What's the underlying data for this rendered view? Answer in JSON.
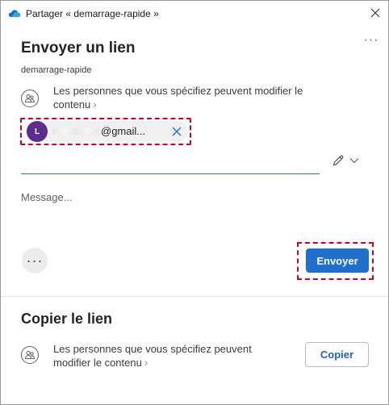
{
  "window": {
    "title": "Partager « demarrage-rapide »",
    "app_icon": "onedrive-cloud-icon",
    "close_icon": "close-icon"
  },
  "send_link": {
    "heading": "Envoyer un lien",
    "file_name": "demarrage-rapide",
    "more_options_glyph": "···",
    "permission_line1": "Les personnes que vous spécifiez peuvent modifier le",
    "permission_line2": "contenu",
    "recipient": {
      "avatar_initial": "L",
      "avatar_color": "#5c2d91",
      "email_visible": "@gmail..."
    },
    "to_placeholder": "",
    "message_placeholder": "Message...",
    "dots_glyph": "···",
    "send_label": "Envoyer",
    "accent_color": "#1f6fcf"
  },
  "copy_link": {
    "heading": "Copier le lien",
    "permission_line1": "Les personnes que vous spécifiez peuvent",
    "permission_line2": "modifier le contenu",
    "copy_label": "Copier"
  },
  "highlight_color": "#d0021b"
}
